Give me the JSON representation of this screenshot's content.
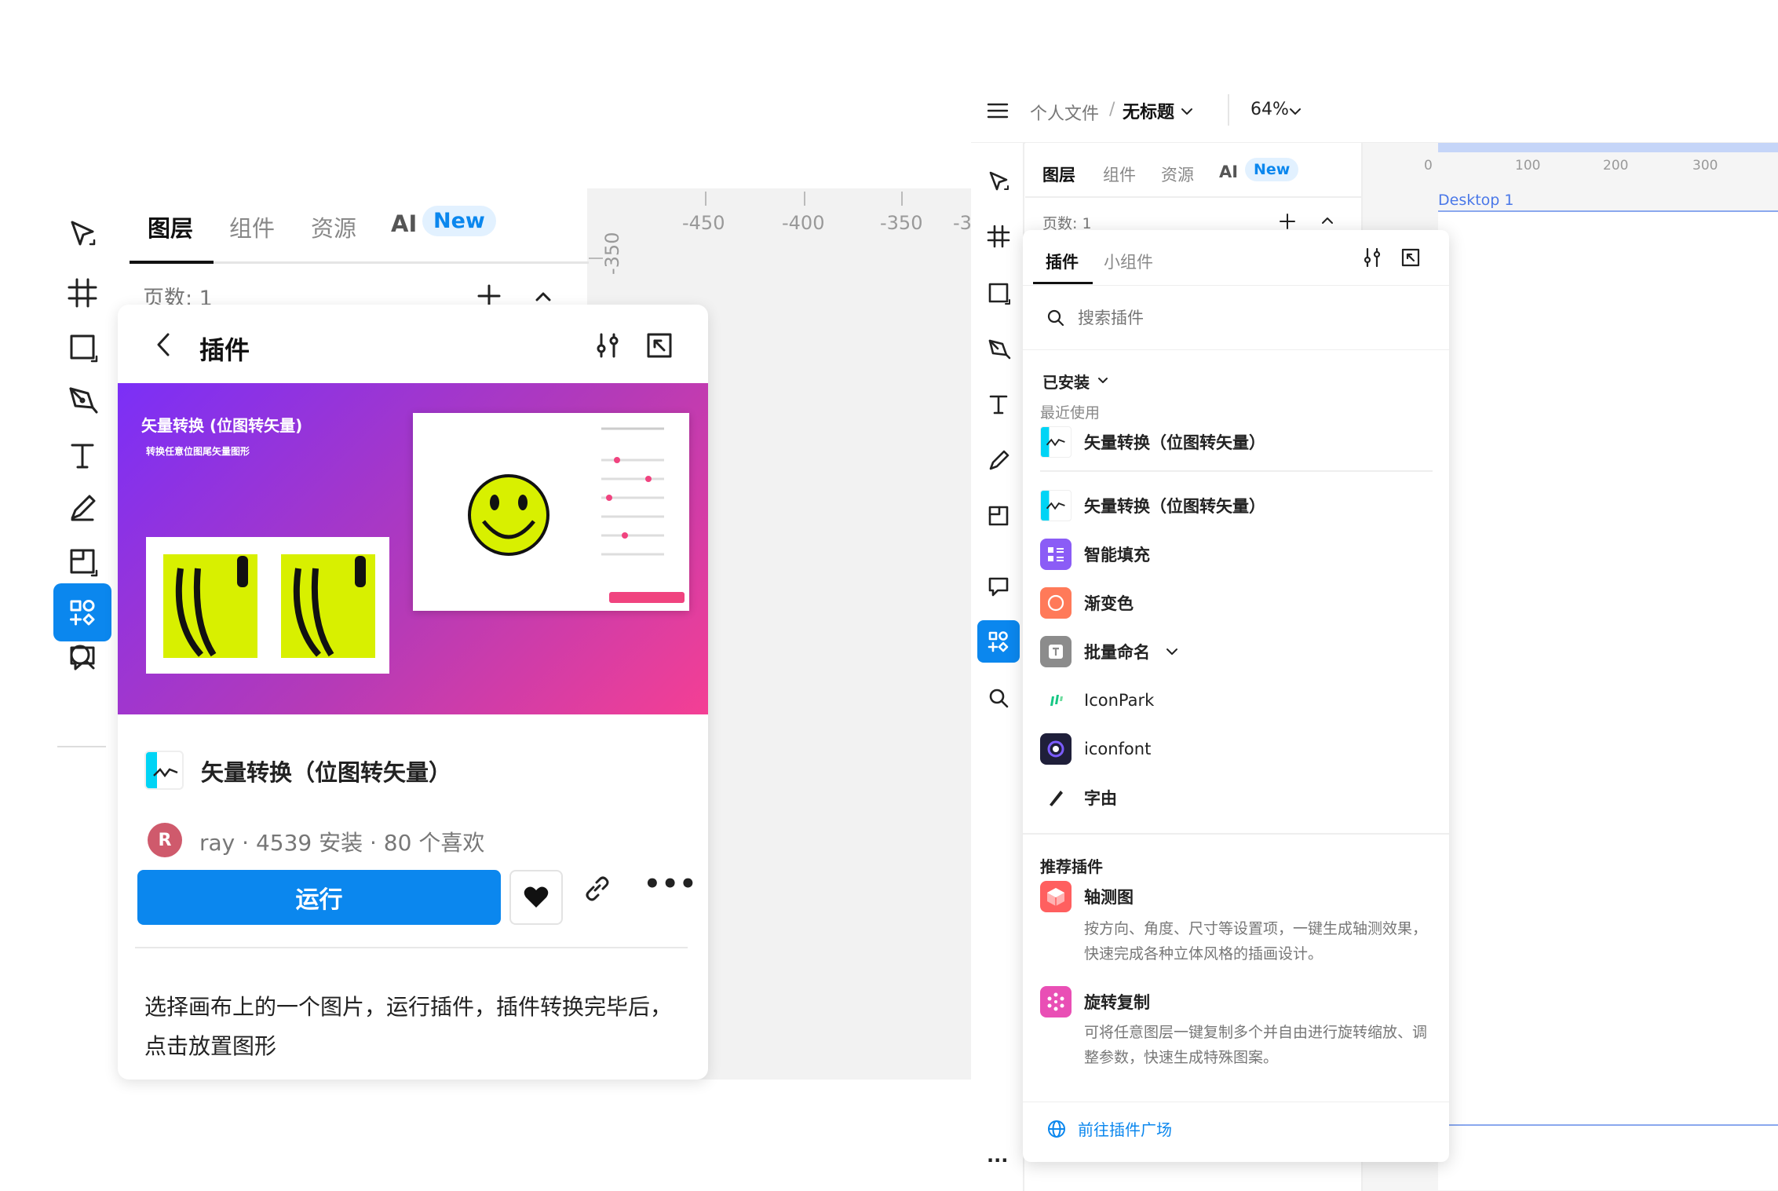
{
  "left": {
    "tabs": [
      "图层",
      "组件",
      "资源",
      "AI"
    ],
    "new_badge": "New",
    "pages_label": "页数: 1",
    "ruler_x": [
      "-450",
      "-400",
      "-350",
      "-3"
    ],
    "ruler_y": "-350",
    "plugin_header_title": "插件",
    "banner_title": "矢量转换 (位图转矢量)",
    "banner_subtitle": "转换任意位图尾矢量图形",
    "plugin_name": "矢量转换（位图转矢量）",
    "author_initial": "R",
    "author_line": "ray · 4539 安装 · 80 个喜欢",
    "run_label": "运行",
    "description": "选择画布上的一个图片，运行插件，插件转换完毕后，点击放置图形"
  },
  "right": {
    "breadcrumb_parent": "个人文件",
    "breadcrumb_sep": "/",
    "file_title": "无标题",
    "zoom": "64%",
    "tabs": [
      "图层",
      "组件",
      "资源",
      "AI"
    ],
    "new_badge": "New",
    "pages_label": "页数: 1",
    "ruler_x": [
      "0",
      "100",
      "200",
      "300"
    ],
    "frame_label": "Desktop 1",
    "panel_tabs": [
      "插件",
      "小组件"
    ],
    "search_placeholder": "搜索插件",
    "installed_label": "已安装",
    "recent_label": "最近使用",
    "recent_items": [
      {
        "name": "矢量转换（位图转矢量）",
        "icon": "vector-convert-icon"
      }
    ],
    "installed_items": [
      {
        "name": "矢量转换（位图转矢量）",
        "icon": "vector-convert-icon",
        "color": "#00d4f5"
      },
      {
        "name": "智能填充",
        "icon": "smart-fill-icon",
        "color": "#8b5cf6"
      },
      {
        "name": "渐变色",
        "icon": "gradient-icon",
        "color": "#ff7a59"
      },
      {
        "name": "批量命名",
        "icon": "batch-rename-icon",
        "color": "#8c8c8c"
      },
      {
        "name": "IconPark",
        "icon": "iconpark-icon",
        "color": "#16c784"
      },
      {
        "name": "iconfont",
        "icon": "iconfont-icon",
        "color": "#1f1f3a"
      },
      {
        "name": "字由",
        "icon": "ziyou-icon",
        "color": "#222222"
      }
    ],
    "recommended_label": "推荐插件",
    "recommended_items": [
      {
        "name": "轴测图",
        "desc": "按方向、角度、尺寸等设置项，一键生成轴测效果，快速完成各种立体风格的插画设计。",
        "color": "#ff5f5f"
      },
      {
        "name": "旋转复制",
        "desc": "可将任意图层一键复制多个并自由进行旋转缩放、调整参数，快速生成特殊图案。",
        "color": "#e94fb5"
      }
    ],
    "footer_link": "前往插件广场"
  },
  "colors": {
    "accent": "#0b87ee",
    "badge_bg": "#e2f1ff"
  }
}
